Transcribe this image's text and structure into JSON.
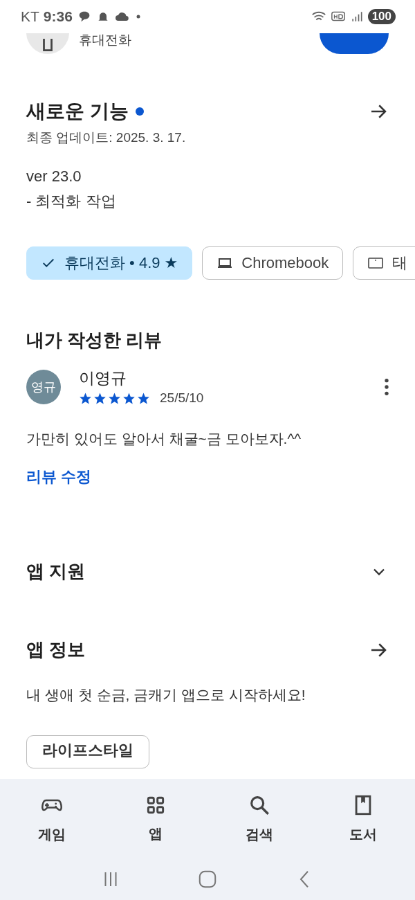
{
  "status_bar": {
    "carrier": "KT",
    "time": "9:36",
    "battery": "100"
  },
  "header": {
    "device_label": "휴대전화"
  },
  "whats_new": {
    "title": "새로운 기능",
    "updated": "최종 업데이트: 2025. 3. 17.",
    "lines": [
      "ver 23.0",
      "- 최적화 작업"
    ]
  },
  "devices": [
    {
      "label": "휴대전화 • 4.9 ★",
      "selected": true
    },
    {
      "kind": "laptop",
      "label": "Chromebook",
      "selected": false
    },
    {
      "kind": "tablet",
      "label": "태",
      "selected": false
    }
  ],
  "my_review": {
    "title": "내가 작성한 리뷰",
    "avatar": "영규",
    "name": "이영규",
    "stars": 5,
    "date": "25/5/10",
    "text": "가만히 있어도 알아서 채굴~금 모아보자.^^",
    "edit_link": "리뷰 수정"
  },
  "app_support": {
    "title": "앱 지원"
  },
  "app_info": {
    "title": "앱 정보",
    "description": "내 생애 첫 순금, 금캐기 앱으로 시작하세요!",
    "tags": [
      "라이프스타일"
    ]
  },
  "bottom_nav": [
    {
      "kind": "games",
      "label": "게임"
    },
    {
      "kind": "apps",
      "label": "앱"
    },
    {
      "kind": "search",
      "label": "검색"
    },
    {
      "kind": "books",
      "label": "도서"
    }
  ]
}
